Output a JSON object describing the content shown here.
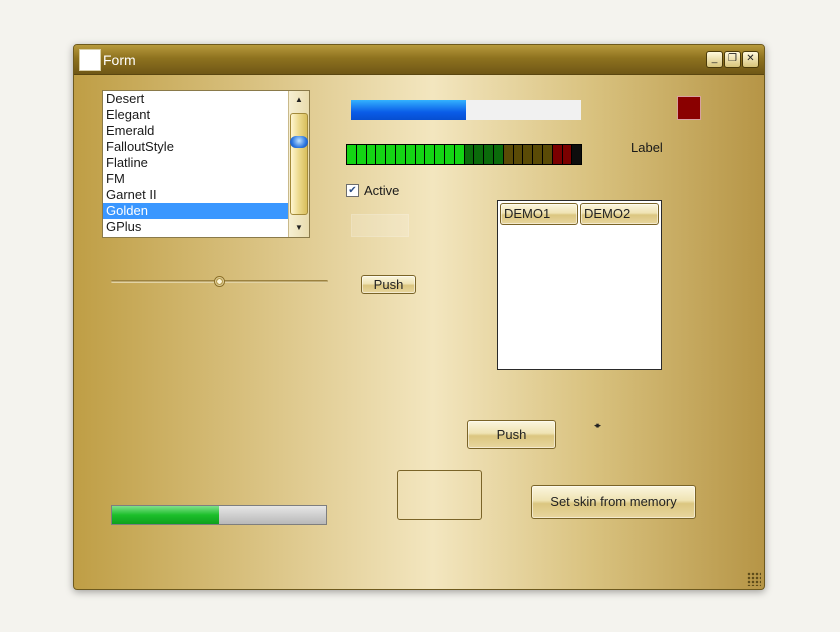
{
  "window": {
    "title": "Form"
  },
  "titlebar_buttons": {
    "minimize": "_",
    "maximize": "❐",
    "close": "✕"
  },
  "listbox": {
    "items": [
      "Desert",
      "Elegant",
      "Emerald",
      "FalloutStyle",
      "Flatline",
      "FM",
      "Garnet II",
      "Golden",
      "GPlus"
    ],
    "selected_index": 7
  },
  "scrollbar": {
    "up_arrow": "▲",
    "down_arrow": "▼"
  },
  "progress_blue": {
    "value_percent": 50,
    "color": "#0a5de8"
  },
  "color_swatch": {
    "color": "#8a0000"
  },
  "led_meter": {
    "segments": 24,
    "lit_green": 12,
    "dark_green": 4,
    "olive": 5,
    "red": 2,
    "colors": {
      "green": "#14d414",
      "dark_green": "#0b6b0b",
      "olive": "#5a4a06",
      "red": "#7a0000",
      "off": "#0d0d0d"
    }
  },
  "label": {
    "text": "Label"
  },
  "checkbox": {
    "label": "Active",
    "checked": true,
    "check_glyph": "✔"
  },
  "slider": {
    "value_percent": 50
  },
  "buttons": {
    "push_small": "Push",
    "push_big": "Push",
    "set_skin": "Set skin from memory"
  },
  "tabs": [
    {
      "label": "DEMO1"
    },
    {
      "label": "DEMO2"
    }
  ],
  "spin_arrows": "◂▸",
  "progress_green": {
    "value_percent": 50,
    "color": "#1cbf2b"
  },
  "accent_colors": {
    "gold_dark": "#8e721f",
    "selection": "#3a97ff"
  }
}
